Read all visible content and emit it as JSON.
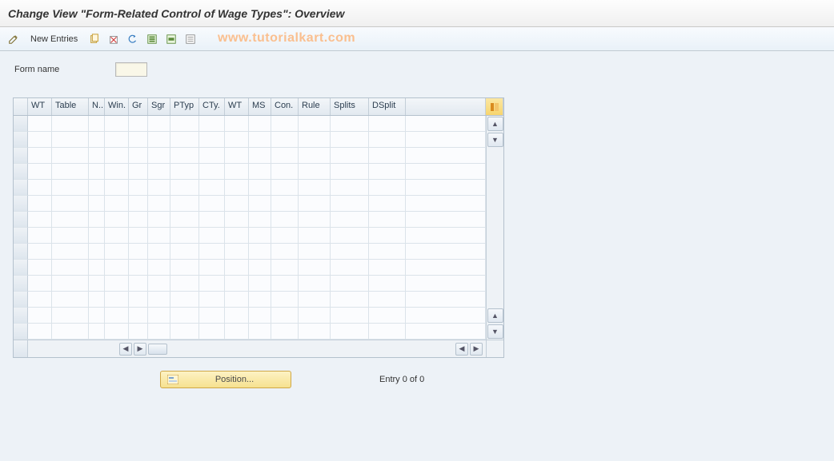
{
  "title": "Change View \"Form-Related Control of Wage Types\": Overview",
  "watermark": "www.tutorialkart.com",
  "toolbar": {
    "new_entries_label": "New Entries"
  },
  "form": {
    "form_name_label": "Form name",
    "form_name_value": ""
  },
  "grid": {
    "columns": [
      "WT",
      "Table",
      "N..",
      "Win.",
      "Gr",
      "Sgr",
      "PTyp",
      "CTy.",
      "WT",
      "MS",
      "Con.",
      "Rule",
      "Splits",
      "DSplit"
    ],
    "rows": [
      [
        null,
        null,
        null,
        null,
        null,
        null,
        null,
        null,
        null,
        null,
        null,
        null,
        null,
        null
      ],
      [
        null,
        null,
        null,
        null,
        null,
        null,
        null,
        null,
        null,
        null,
        null,
        null,
        null,
        null
      ],
      [
        null,
        null,
        null,
        null,
        null,
        null,
        null,
        null,
        null,
        null,
        null,
        null,
        null,
        null
      ],
      [
        null,
        null,
        null,
        null,
        null,
        null,
        null,
        null,
        null,
        null,
        null,
        null,
        null,
        null
      ],
      [
        null,
        null,
        null,
        null,
        null,
        null,
        null,
        null,
        null,
        null,
        null,
        null,
        null,
        null
      ],
      [
        null,
        null,
        null,
        null,
        null,
        null,
        null,
        null,
        null,
        null,
        null,
        null,
        null,
        null
      ],
      [
        null,
        null,
        null,
        null,
        null,
        null,
        null,
        null,
        null,
        null,
        null,
        null,
        null,
        null
      ],
      [
        null,
        null,
        null,
        null,
        null,
        null,
        null,
        null,
        null,
        null,
        null,
        null,
        null,
        null
      ],
      [
        null,
        null,
        null,
        null,
        null,
        null,
        null,
        null,
        null,
        null,
        null,
        null,
        null,
        null
      ],
      [
        null,
        null,
        null,
        null,
        null,
        null,
        null,
        null,
        null,
        null,
        null,
        null,
        null,
        null
      ],
      [
        null,
        null,
        null,
        null,
        null,
        null,
        null,
        null,
        null,
        null,
        null,
        null,
        null,
        null
      ],
      [
        null,
        null,
        null,
        null,
        null,
        null,
        null,
        null,
        null,
        null,
        null,
        null,
        null,
        null
      ],
      [
        null,
        null,
        null,
        null,
        null,
        null,
        null,
        null,
        null,
        null,
        null,
        null,
        null,
        null
      ],
      [
        null,
        null,
        null,
        null,
        null,
        null,
        null,
        null,
        null,
        null,
        null,
        null,
        null,
        null
      ]
    ]
  },
  "position_button_label": "Position...",
  "entry_text": "Entry 0 of 0"
}
